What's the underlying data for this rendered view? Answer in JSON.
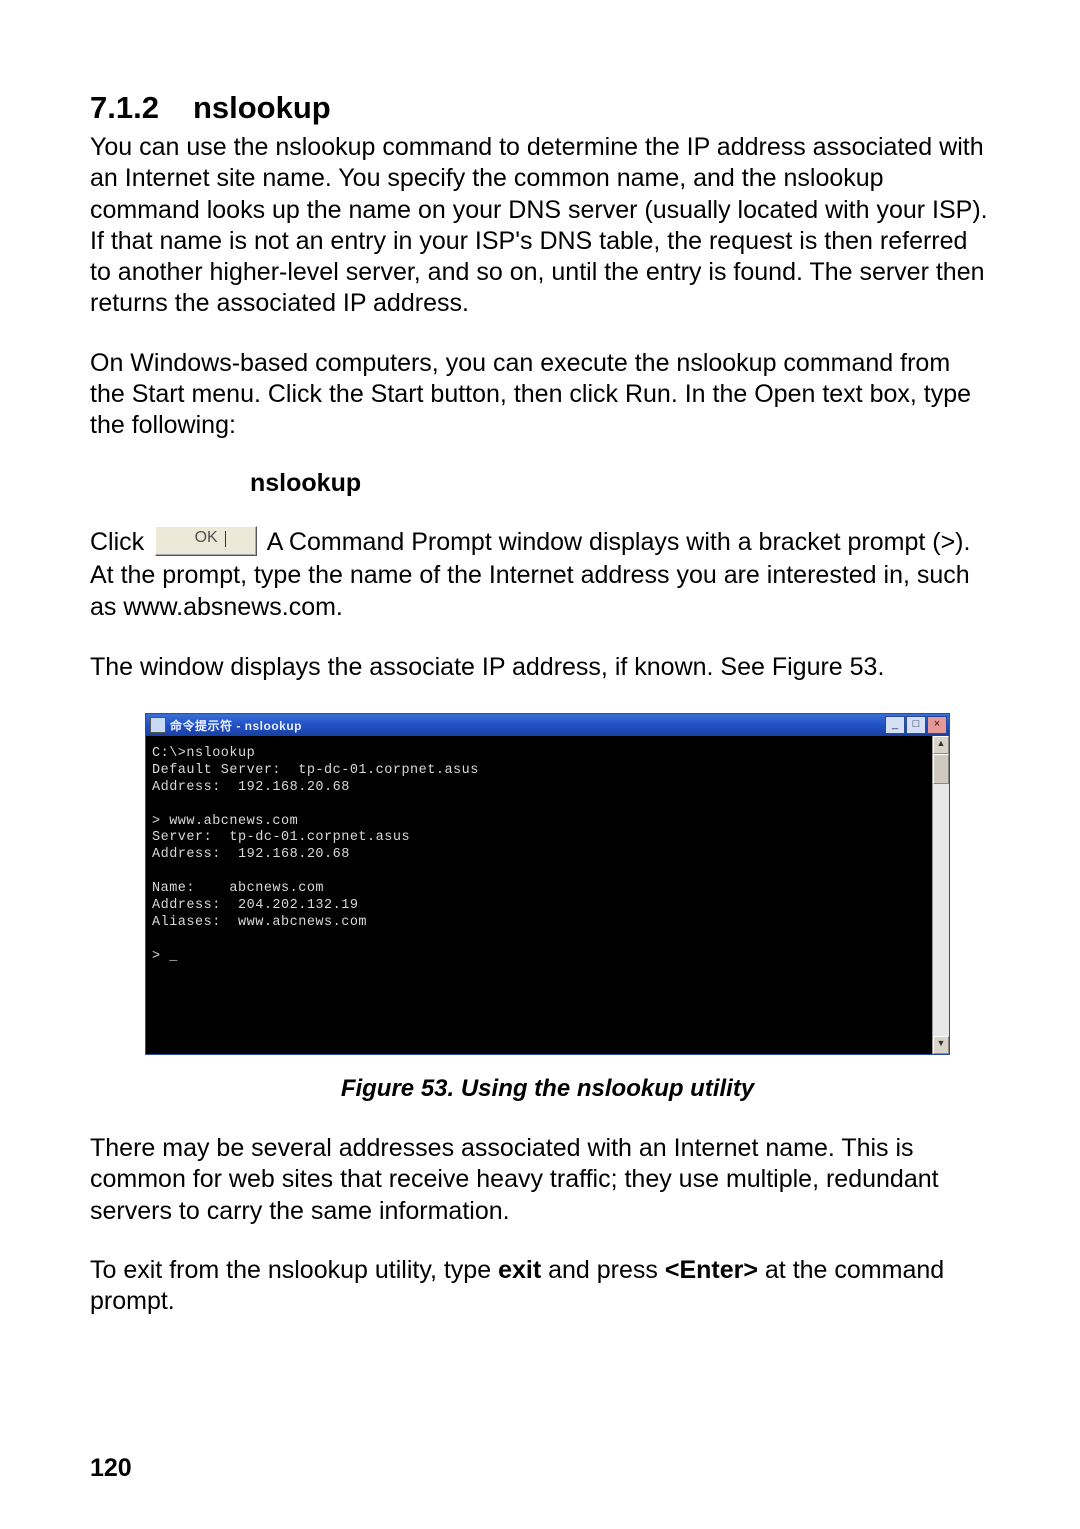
{
  "section": {
    "number": "7.1.2",
    "title": "nslookup"
  },
  "paragraphs": {
    "p1": "You can use the nslookup command to determine the IP address associated with an Internet site name. You specify the common name, and the nslookup command looks up the name on your DNS server (usually located with your ISP). If that name is not an entry in your ISP's DNS table, the request is then referred to another higher-level server, and so on, until the entry is found. The server then returns the associated IP address.",
    "p2": "On Windows-based computers, you can execute the nslookup command from the Start menu. Click the Start button, then click Run. In the Open text box, type the following:",
    "command_label": "nslookup",
    "click_prefix": "Click",
    "ok_label": "OK",
    "click_suffix": " A Command Prompt window displays with a bracket prompt (>). At the prompt, type the name of the Internet address you are interested in, such as www.absnews.com.",
    "p3": "The window displays the associate IP address, if known. See Figure 53.",
    "p4": "There may be several addresses associated with an Internet name. This is common for web sites that receive heavy traffic; they use multiple, redundant servers to carry the same information.",
    "exit_prefix": "To exit from the nslookup utility, type ",
    "exit_cmd": "exit",
    "exit_mid": " and press ",
    "exit_key": "<Enter>",
    "exit_suffix": " at the command prompt."
  },
  "figure": {
    "caption": "Figure 53.  Using the nslookup utility",
    "window_title": "命令提示符 - nslookup",
    "min_label": "_",
    "max_label": "□",
    "close_label": "×",
    "up_label": "▲",
    "down_label": "▼",
    "terminal_text": "C:\\>nslookup\nDefault Server:  tp-dc-01.corpnet.asus\nAddress:  192.168.20.68\n\n> www.abcnews.com\nServer:  tp-dc-01.corpnet.asus\nAddress:  192.168.20.68\n\nName:    abcnews.com\nAddress:  204.202.132.19\nAliases:  www.abcnews.com\n\n> _"
  },
  "page_number": "120"
}
